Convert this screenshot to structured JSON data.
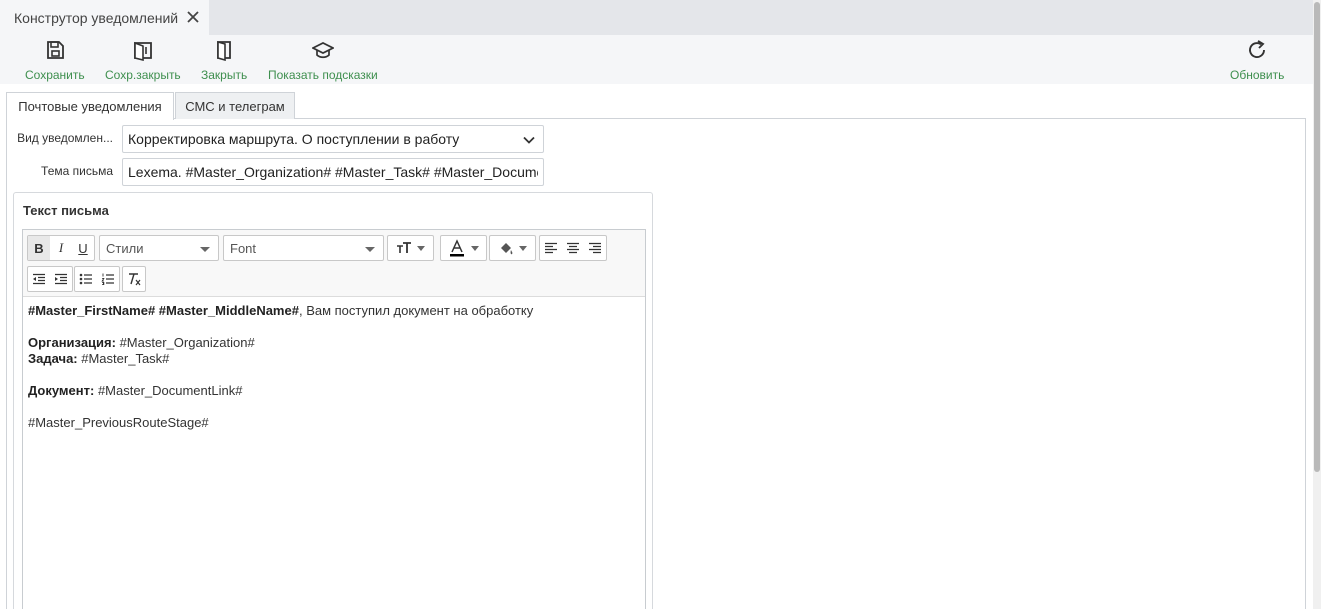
{
  "doc_tab": {
    "title": "Конструтор уведомлений"
  },
  "toolbar": {
    "save": "Сохранить",
    "save_close": "Сохр.закрыть",
    "close": "Закрыть",
    "show_hints": "Показать подсказки",
    "refresh": "Обновить"
  },
  "tabs": [
    {
      "label": "Почтовые уведомления",
      "active": true
    },
    {
      "label": "СМС и телеграм",
      "active": false
    }
  ],
  "form": {
    "type_label": "Вид уведомлен...",
    "type_value": "Корректировка маршрута. О поступлении в работу",
    "subject_label": "Тема письма",
    "subject_value": "Lexema. #Master_Organization# #Master_Task# #Master_DocumentLink#"
  },
  "letter": {
    "title": "Текст письма",
    "styles_combo": "Стили",
    "font_combo": "Font",
    "lines": [
      {
        "bold": "#Master_FirstName# #Master_MiddleName#",
        "text": ", Вам поступил документ на обработку"
      },
      {
        "bold": "",
        "text": ""
      },
      {
        "bold": "Организация:",
        "text": " #Master_Organization#"
      },
      {
        "bold": "Задача:",
        "text": " #Master_Task#"
      },
      {
        "bold": "",
        "text": ""
      },
      {
        "bold": "Документ:",
        "text": " #Master_DocumentLink#"
      },
      {
        "bold": "",
        "text": ""
      },
      {
        "bold": "",
        "text": "#Master_PreviousRouteStage#"
      }
    ]
  },
  "colors": {
    "accent_green": "#3e8f4e",
    "border": "#cfd3d8"
  }
}
